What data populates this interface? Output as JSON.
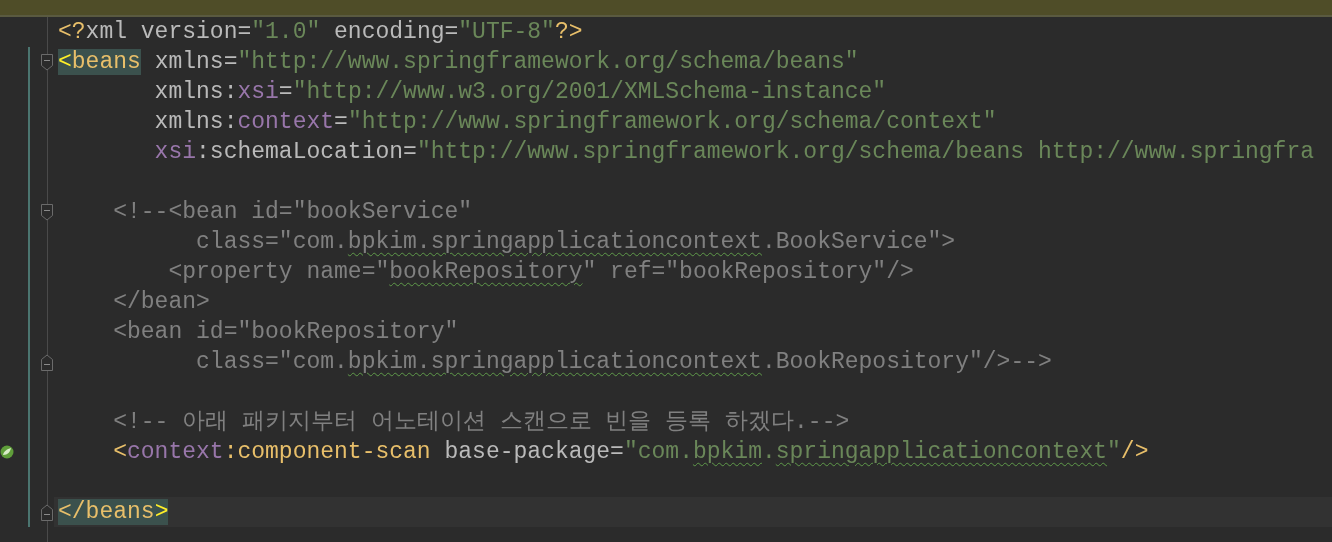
{
  "editor": {
    "lines": [
      {
        "kind": "code",
        "changed": false,
        "current": false,
        "fold_open": false,
        "fold_close": false,
        "gutter_icon": false,
        "tokens": [
          {
            "kind": "punct",
            "text": "<?"
          },
          {
            "kind": "attr",
            "text": "xml version="
          },
          {
            "kind": "str",
            "text": "\"1.0\""
          },
          {
            "kind": "attr",
            "text": " encoding="
          },
          {
            "kind": "str",
            "text": "\"UTF-8\""
          },
          {
            "kind": "punct",
            "text": "?>"
          }
        ]
      },
      {
        "kind": "code",
        "changed": true,
        "current": false,
        "fold_open": true,
        "fold_close": false,
        "gutter_icon": false,
        "tokens": [
          {
            "kind": "bracket",
            "match": true,
            "text": "<"
          },
          {
            "kind": "tag",
            "match": true,
            "text": "beans"
          },
          {
            "kind": "attr",
            "text": " xmlns="
          },
          {
            "kind": "str",
            "text": "\"http://www.springframework.org/schema/beans\""
          }
        ]
      },
      {
        "kind": "code",
        "changed": true,
        "current": false,
        "fold_open": false,
        "fold_close": false,
        "gutter_icon": false,
        "tokens": [
          {
            "kind": "attr",
            "text": "       xmlns:"
          },
          {
            "kind": "ns",
            "text": "xsi"
          },
          {
            "kind": "attr",
            "text": "="
          },
          {
            "kind": "str",
            "text": "\"http://www.w3.org/2001/XMLSchema-instance\""
          }
        ]
      },
      {
        "kind": "code",
        "changed": true,
        "current": false,
        "fold_open": false,
        "fold_close": false,
        "gutter_icon": false,
        "tokens": [
          {
            "kind": "attr",
            "text": "       xmlns:"
          },
          {
            "kind": "ns",
            "text": "context"
          },
          {
            "kind": "attr",
            "text": "="
          },
          {
            "kind": "str",
            "text": "\"http://www.springframework.org/schema/context\""
          }
        ]
      },
      {
        "kind": "code",
        "changed": true,
        "current": false,
        "fold_open": false,
        "fold_close": false,
        "gutter_icon": false,
        "tokens": [
          {
            "kind": "ns",
            "text": "       xsi"
          },
          {
            "kind": "attr",
            "text": ":schemaLocation="
          },
          {
            "kind": "str",
            "text": "\"http://www.springframework.org/schema/beans http://www.springfra"
          }
        ]
      },
      {
        "kind": "blank",
        "changed": true,
        "current": false,
        "fold_open": false,
        "fold_close": false,
        "gutter_icon": false
      },
      {
        "kind": "code",
        "changed": true,
        "current": false,
        "fold_open": true,
        "fold_close": false,
        "gutter_icon": false,
        "tokens": [
          {
            "kind": "comment",
            "text": "    <!--<bean id=\"bookService\""
          }
        ]
      },
      {
        "kind": "code",
        "changed": true,
        "current": false,
        "fold_open": false,
        "fold_close": false,
        "gutter_icon": false,
        "tokens": [
          {
            "kind": "comment",
            "typo": false,
            "text": "          class=\"com."
          },
          {
            "kind": "comment",
            "typo": true,
            "text": "bpkim.springapplicationcontext"
          },
          {
            "kind": "comment",
            "typo": false,
            "text": ".BookService\">"
          }
        ]
      },
      {
        "kind": "code",
        "changed": true,
        "current": false,
        "fold_open": false,
        "fold_close": false,
        "gutter_icon": false,
        "tokens": [
          {
            "kind": "comment",
            "typo": false,
            "text": "        <property name=\""
          },
          {
            "kind": "comment",
            "typo": true,
            "text": "bookRepository"
          },
          {
            "kind": "comment",
            "typo": false,
            "text": "\" ref=\"bookRepository\"/>"
          }
        ]
      },
      {
        "kind": "code",
        "changed": true,
        "current": false,
        "fold_open": false,
        "fold_close": false,
        "gutter_icon": false,
        "tokens": [
          {
            "kind": "comment",
            "text": "    </bean>"
          }
        ]
      },
      {
        "kind": "code",
        "changed": true,
        "current": false,
        "fold_open": false,
        "fold_close": false,
        "gutter_icon": false,
        "tokens": [
          {
            "kind": "comment",
            "text": "    <bean id=\"bookRepository\""
          }
        ]
      },
      {
        "kind": "code",
        "changed": true,
        "current": false,
        "fold_open": false,
        "fold_close": true,
        "gutter_icon": false,
        "tokens": [
          {
            "kind": "comment",
            "typo": false,
            "text": "          class=\"com."
          },
          {
            "kind": "comment",
            "typo": true,
            "text": "bpkim.springapplicationcontext"
          },
          {
            "kind": "comment",
            "typo": false,
            "text": ".BookRepository\"/>-->"
          }
        ]
      },
      {
        "kind": "blank",
        "changed": true,
        "current": false,
        "fold_open": false,
        "fold_close": false,
        "gutter_icon": false
      },
      {
        "kind": "code",
        "changed": true,
        "current": false,
        "fold_open": false,
        "fold_close": false,
        "gutter_icon": false,
        "tokens": [
          {
            "kind": "comment",
            "text": "    <!-- 아래 패키지부터 어노테이션 스캔으로 빈을 등록 하겠다.-->"
          }
        ]
      },
      {
        "kind": "code",
        "changed": true,
        "current": false,
        "fold_open": false,
        "fold_close": false,
        "gutter_icon": true,
        "tokens": [
          {
            "kind": "punct",
            "text": "    <"
          },
          {
            "kind": "ns",
            "text": "context"
          },
          {
            "kind": "tag",
            "text": ":component-scan"
          },
          {
            "kind": "attr",
            "text": " base-package="
          },
          {
            "kind": "str",
            "typo": false,
            "text": "\"com."
          },
          {
            "kind": "str",
            "typo": true,
            "text": "bpkim"
          },
          {
            "kind": "str",
            "typo": false,
            "text": "."
          },
          {
            "kind": "str",
            "typo": true,
            "text": "springapplicationcontext"
          },
          {
            "kind": "str",
            "typo": false,
            "text": "\""
          },
          {
            "kind": "punct",
            "text": "/>"
          }
        ]
      },
      {
        "kind": "blank",
        "changed": true,
        "current": false,
        "fold_open": false,
        "fold_close": false,
        "gutter_icon": false
      },
      {
        "kind": "code",
        "changed": true,
        "current": true,
        "fold_open": false,
        "fold_close": true,
        "gutter_icon": false,
        "tokens": [
          {
            "kind": "punct",
            "match": true,
            "text": "</"
          },
          {
            "kind": "tag",
            "match": true,
            "text": "beans"
          },
          {
            "kind": "bracket",
            "match": true,
            "text": ">"
          }
        ]
      }
    ]
  }
}
